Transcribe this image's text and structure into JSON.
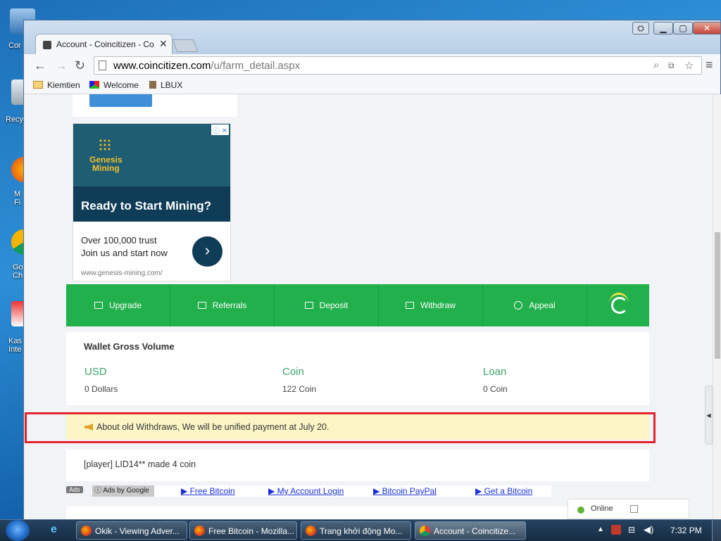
{
  "desktop": {
    "labels": [
      "Cor",
      "Recy",
      "M\nFi",
      "Go\nCh",
      "Kas\nInte"
    ]
  },
  "browser": {
    "tab_title": "Account - Coincitizen - Co",
    "url_domain": "www.coincitizen.com",
    "url_path": "/u/farm_detail.aspx",
    "bookmarks": [
      "Kiemtien",
      "Welcome",
      "LBUX"
    ]
  },
  "ad": {
    "brand_line1": "Genesis",
    "brand_line2": "Mining",
    "headline": "Ready to Start Mining?",
    "body_line1": "Over 100,000 trust",
    "body_line2": "Join us and start now",
    "site": "www.genesis-mining.com/"
  },
  "nav": {
    "items": [
      {
        "label": "Upgrade"
      },
      {
        "label": "Referrals"
      },
      {
        "label": "Deposit"
      },
      {
        "label": "Withdraw"
      },
      {
        "label": "Appeal"
      }
    ]
  },
  "wallet": {
    "title": "Wallet Gross Volume",
    "cols": [
      {
        "label": "USD",
        "value": "0 Dollars"
      },
      {
        "label": "Coin",
        "value": "122 Coin"
      },
      {
        "label": "Loan",
        "value": "0 Coin"
      }
    ]
  },
  "notice": {
    "text": "About old Withdraws, We will be unified payment at July 20."
  },
  "feed": {
    "text": "[player] LID14** made 4 coin"
  },
  "ads_row": {
    "badge": "Ads",
    "by": "Ads by Google",
    "links": [
      "▶ Free Bitcoin",
      "▶ My Account Login",
      "▶ Bitcoin PayPal",
      "▶ Get a Bitcoin"
    ]
  },
  "chat": {
    "status": "Online"
  },
  "taskbar": {
    "tasks": [
      {
        "title": "Okik - Viewing Adver..."
      },
      {
        "title": "Free Bitcoin - Mozilla..."
      },
      {
        "title": "Trang khởi động Mo..."
      },
      {
        "title": "Account - Coincitize..."
      }
    ],
    "clock": "7:32 PM"
  },
  "colors": {
    "nav_green": "#21b04b",
    "wallet_label_green": "#3aa36a",
    "notice_bg": "#fcf6c7",
    "highlight_red": "#e3232b",
    "ad_link_blue": "#1a2fd9"
  }
}
